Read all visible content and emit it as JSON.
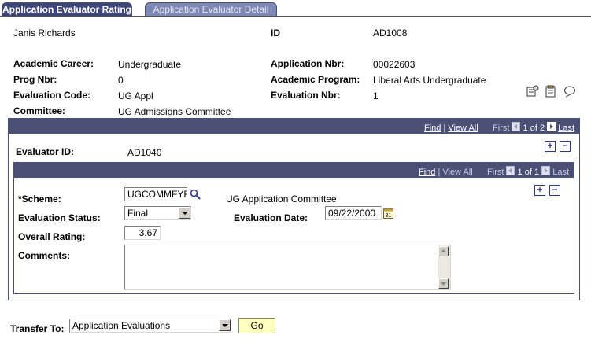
{
  "tabs": [
    {
      "label": "Application Evaluator Rating",
      "active": true
    },
    {
      "label": "Application Evaluator Detail",
      "active": false
    }
  ],
  "header": {
    "name": "Janis Richards",
    "id_label": "ID",
    "id_value": "AD1008",
    "academic_career_label": "Academic Career:",
    "academic_career_value": "Undergraduate",
    "application_nbr_label": "Application Nbr:",
    "application_nbr_value": "00022603",
    "prog_nbr_label": "Prog Nbr:",
    "prog_nbr_value": "0",
    "academic_program_label": "Academic Program:",
    "academic_program_value": "Liberal Arts Undergraduate",
    "evaluation_code_label": "Evaluation Code:",
    "evaluation_code_value": "UG Appl",
    "evaluation_nbr_label": "Evaluation Nbr:",
    "evaluation_nbr_value": "1",
    "committee_label": "Committee:",
    "committee_value": "UG Admissions Committee"
  },
  "icons": [
    "worklist-icon",
    "notepad-icon",
    "comment-bubble-icon"
  ],
  "outer_nav": {
    "find": "Find",
    "sep": "|",
    "view_all": "View All",
    "first": "First",
    "count": "1 of 2",
    "last": "Last"
  },
  "evaluator": {
    "label": "Evaluator ID:",
    "value": "AD1040"
  },
  "inner_nav": {
    "find": "Find",
    "sep": "|",
    "view_all": "View All",
    "first": "First",
    "count": "1 of 1",
    "last": "Last"
  },
  "form": {
    "scheme_label": "*Scheme:",
    "scheme_value": "UGCOMMFYR",
    "scheme_description": "UG Application Committee",
    "status_label": "Evaluation Status:",
    "status_value": "Final",
    "eval_date_label": "Evaluation Date:",
    "eval_date_value": "09/22/2000",
    "overall_rating_label": "Overall Rating:",
    "overall_rating_value": "3.67",
    "comments_label": "Comments:",
    "comments_value": ""
  },
  "transfer": {
    "label": "Transfer To:",
    "value": "Application Evaluations",
    "go_label": "Go"
  },
  "colors": {
    "header_bar": "#4a4f76",
    "tab_active": "#3d4578",
    "tab_inactive": "#7e88b4",
    "go_button": "#ffffc0"
  }
}
